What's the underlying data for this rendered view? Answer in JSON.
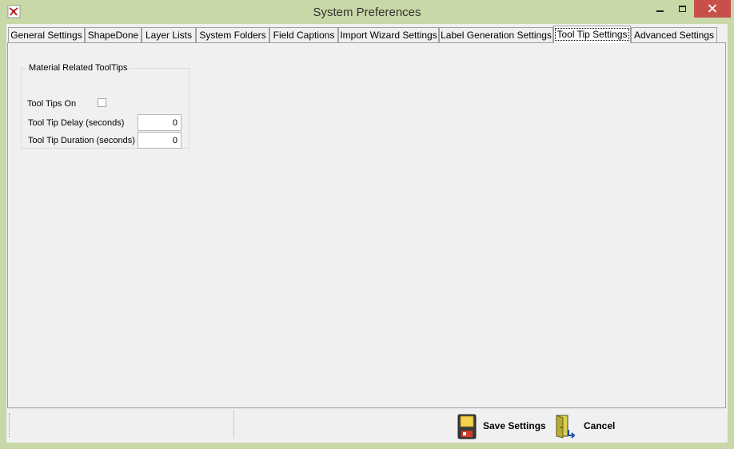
{
  "window": {
    "title": "System Preferences",
    "app_icon": "app-logo-icon",
    "controls": [
      "minimize-icon",
      "maximize-icon",
      "close-icon"
    ],
    "close_color": "#c7504b"
  },
  "tabs": [
    {
      "label": "General Settings",
      "active": false
    },
    {
      "label": "ShapeDone",
      "active": false
    },
    {
      "label": "Layer Lists",
      "active": false
    },
    {
      "label": "System Folders",
      "active": false
    },
    {
      "label": "Field Captions",
      "active": false
    },
    {
      "label": "Import Wizard Settings",
      "active": false
    },
    {
      "label": "Label Generation Settings",
      "active": false
    },
    {
      "label": "Tool Tip Settings",
      "active": true
    },
    {
      "label": "Advanced Settings",
      "active": false
    }
  ],
  "tooltip_group": {
    "legend": "Material Related ToolTips",
    "tooltips_on_label": "Tool Tips On",
    "tooltips_on_checked": false,
    "delay_label": "Tool Tip Delay (seconds)",
    "delay_value": "0",
    "duration_label": "Tool Tip Duration (seconds)",
    "duration_value": "0"
  },
  "footer": {
    "save_label": "Save Settings",
    "save_icon": "floppy-disk-icon",
    "cancel_label": "Cancel",
    "cancel_icon": "exit-door-icon"
  }
}
